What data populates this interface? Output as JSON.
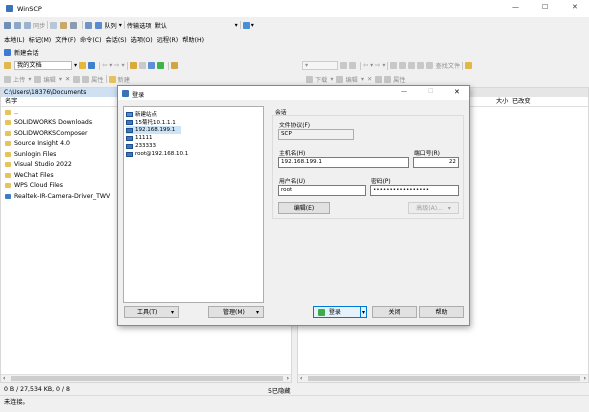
{
  "window": {
    "title": "WinSCP",
    "controls": {
      "minimize": "—",
      "maximize": "☐",
      "close": "✕"
    }
  },
  "toolbar1": {
    "sync_label": "同步",
    "queue_label": "队列",
    "transfer_label": "传输选项",
    "transfer_value": "默认"
  },
  "menu": [
    "本地(L)",
    "标记(M)",
    "文件(F)",
    "命令(C)",
    "会话(S)",
    "选项(O)",
    "远程(R)",
    "帮助(H)"
  ],
  "new_session_tab": "新建会话",
  "left_toolbar": {
    "location": "我的文档",
    "upload": "上传",
    "edit": "编辑",
    "properties": "属性",
    "new": "新建"
  },
  "right_toolbar": {
    "download": "下载",
    "edit": "编辑",
    "properties": "属性",
    "find_files": "查找文件"
  },
  "left_path": "C:\\Users\\18376\\Documents",
  "left_header": {
    "name": "名字"
  },
  "right_header": {
    "size": "大小",
    "changed": "已改变"
  },
  "left_files": [
    "..",
    "SOLIDWORKS Downloads",
    "SOLIDWORKSComposer",
    "Source Insight 4.0",
    "Sunlogin Files",
    "Visual Studio 2022",
    "WeChat Files",
    "WPS Cloud Files",
    "Realtek-IR-Camera-Driver_TWV"
  ],
  "status": {
    "left_size": "0 B / 27,534 KB,  0 / 8",
    "hidden": "5已隐藏",
    "connection": "未连接。"
  },
  "dialog": {
    "title": "登录",
    "sites": [
      "新建站点",
      "15菊托10.1.1.1",
      "192.168.199.1",
      "11111",
      "233333",
      "root@192.168.10.1"
    ],
    "session_group": "会话",
    "protocol_label": "文件协议(F)",
    "protocol_value": "SCP",
    "host_label": "主机名(H)",
    "host_value": "192.168.199.1",
    "port_label": "端口号(R)",
    "port_value": "22",
    "user_label": "用户名(U)",
    "user_value": "root",
    "password_label": "密码(P)",
    "password_value": "•••••••••••••••••",
    "edit_button": "编辑(E)",
    "advanced_button": "高级(A)...",
    "tools_button": "工具(T)",
    "manage_button": "管理(M)",
    "login_button": "登录",
    "close_button": "关闭",
    "help_button": "帮助"
  }
}
